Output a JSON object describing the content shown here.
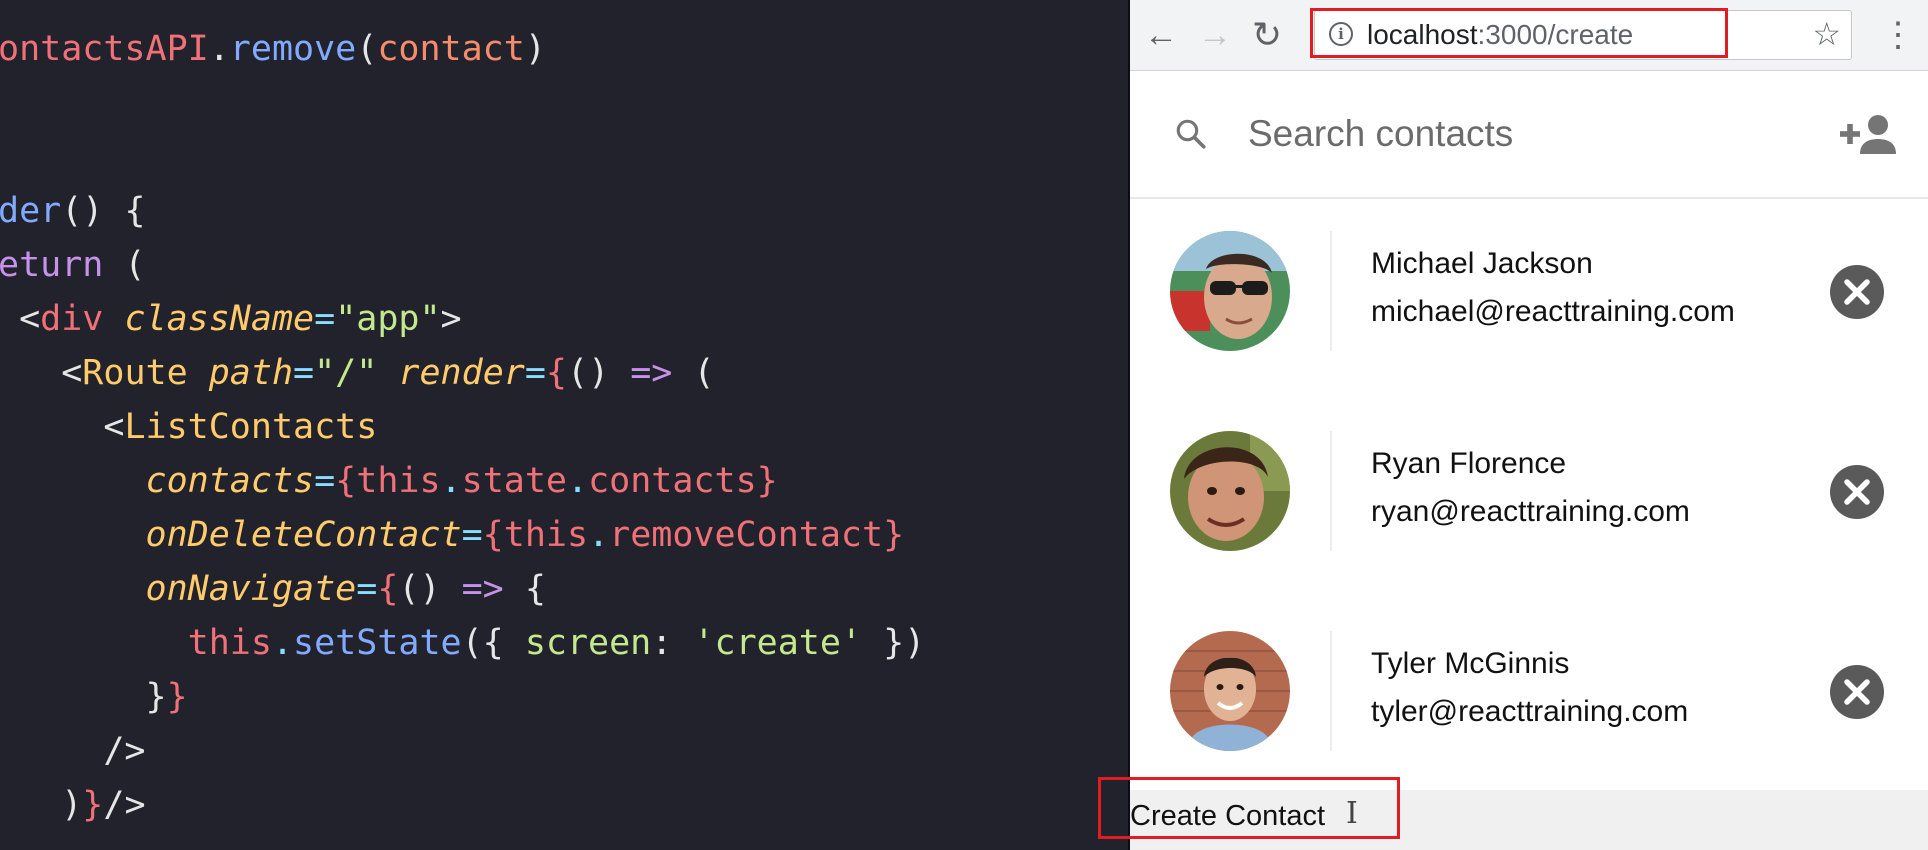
{
  "editor": {
    "lines": [
      [
        {
          "t": "ontactsAPI",
          "c": "#f07178"
        },
        {
          "t": ".",
          "c": "#e6e6e6"
        },
        {
          "t": "remove",
          "c": "#82aaff"
        },
        {
          "t": "(",
          "c": "#e6e6e6"
        },
        {
          "t": "contact",
          "c": "#f78c6c"
        },
        {
          "t": ")",
          "c": "#e6e6e6"
        }
      ],
      [],
      [],
      [
        {
          "t": "der",
          "c": "#82aaff"
        },
        {
          "t": "() {",
          "c": "#e6e6e6"
        }
      ],
      [
        {
          "t": "eturn",
          "c": "#c792ea"
        },
        {
          "t": " (",
          "c": "#e6e6e6"
        }
      ],
      [
        {
          "t": " <",
          "c": "#e6e6e6"
        },
        {
          "t": "div",
          "c": "#f07178"
        },
        {
          "t": " ",
          "c": "#e6e6e6"
        },
        {
          "t": "className",
          "c": "#ffcb6b",
          "i": true
        },
        {
          "t": "=",
          "c": "#89ddff"
        },
        {
          "t": "\"app\"",
          "c": "#c3e88d"
        },
        {
          "t": ">",
          "c": "#e6e6e6"
        }
      ],
      [
        {
          "t": "   <",
          "c": "#e6e6e6"
        },
        {
          "t": "Route",
          "c": "#ffcb6b"
        },
        {
          "t": " ",
          "c": "#e6e6e6"
        },
        {
          "t": "path",
          "c": "#ffcb6b",
          "i": true
        },
        {
          "t": "=",
          "c": "#89ddff"
        },
        {
          "t": "\"/\"",
          "c": "#c3e88d"
        },
        {
          "t": " ",
          "c": "#e6e6e6"
        },
        {
          "t": "render",
          "c": "#ffcb6b",
          "i": true
        },
        {
          "t": "=",
          "c": "#89ddff"
        },
        {
          "t": "{",
          "c": "#f07178"
        },
        {
          "t": "() ",
          "c": "#e6e6e6"
        },
        {
          "t": "=>",
          "c": "#c792ea"
        },
        {
          "t": " (",
          "c": "#e6e6e6"
        }
      ],
      [
        {
          "t": "     <",
          "c": "#e6e6e6"
        },
        {
          "t": "ListContacts",
          "c": "#ffcb6b"
        }
      ],
      [
        {
          "t": "       ",
          "c": "#e6e6e6"
        },
        {
          "t": "contacts",
          "c": "#ffcb6b",
          "i": true
        },
        {
          "t": "=",
          "c": "#89ddff"
        },
        {
          "t": "{",
          "c": "#f07178"
        },
        {
          "t": "this",
          "c": "#f07178"
        },
        {
          "t": ".",
          "c": "#89ddff"
        },
        {
          "t": "state",
          "c": "#f07178"
        },
        {
          "t": ".",
          "c": "#89ddff"
        },
        {
          "t": "contacts",
          "c": "#f07178"
        },
        {
          "t": "}",
          "c": "#f07178"
        }
      ],
      [
        {
          "t": "       ",
          "c": "#e6e6e6"
        },
        {
          "t": "onDeleteContact",
          "c": "#ffcb6b",
          "i": true
        },
        {
          "t": "=",
          "c": "#89ddff"
        },
        {
          "t": "{",
          "c": "#f07178"
        },
        {
          "t": "this",
          "c": "#f07178"
        },
        {
          "t": ".",
          "c": "#89ddff"
        },
        {
          "t": "removeContact",
          "c": "#f07178"
        },
        {
          "t": "}",
          "c": "#f07178"
        }
      ],
      [
        {
          "t": "       ",
          "c": "#e6e6e6"
        },
        {
          "t": "onNavigate",
          "c": "#ffcb6b",
          "i": true
        },
        {
          "t": "=",
          "c": "#89ddff"
        },
        {
          "t": "{",
          "c": "#f07178"
        },
        {
          "t": "() ",
          "c": "#e6e6e6"
        },
        {
          "t": "=>",
          "c": "#c792ea"
        },
        {
          "t": " {",
          "c": "#e6e6e6"
        }
      ],
      [
        {
          "t": "         ",
          "c": "#e6e6e6"
        },
        {
          "t": "this",
          "c": "#f07178"
        },
        {
          "t": ".",
          "c": "#89ddff"
        },
        {
          "t": "setState",
          "c": "#82aaff"
        },
        {
          "t": "({ ",
          "c": "#e6e6e6"
        },
        {
          "t": "screen",
          "c": "#c3e88d"
        },
        {
          "t": ": ",
          "c": "#e6e6e6"
        },
        {
          "t": "'create'",
          "c": "#c3e88d"
        },
        {
          "t": " })",
          "c": "#e6e6e6"
        }
      ],
      [
        {
          "t": "       }",
          "c": "#e6e6e6"
        },
        {
          "t": "}",
          "c": "#f07178"
        }
      ],
      [
        {
          "t": "     />",
          "c": "#e6e6e6"
        }
      ],
      [
        {
          "t": "   )",
          "c": "#e6e6e6"
        },
        {
          "t": "}",
          "c": "#f07178"
        },
        {
          "t": "/>",
          "c": "#e6e6e6"
        }
      ]
    ]
  },
  "browser": {
    "back_icon": "back-arrow",
    "forward_icon": "forward-arrow",
    "reload_icon": "reload",
    "url_host": "localhost",
    "url_path": ":3000/create",
    "bookmark_icon": "star",
    "menu_icon": "vertical-dots",
    "highlight_color": "#e31b23"
  },
  "search": {
    "placeholder": "Search contacts",
    "value": ""
  },
  "contacts": [
    {
      "name": "Michael Jackson",
      "email": "michael@reacttraining.com"
    },
    {
      "name": "Ryan Florence",
      "email": "ryan@reacttraining.com"
    },
    {
      "name": "Tyler McGinnis",
      "email": "tyler@reacttraining.com"
    }
  ],
  "footer": {
    "create_link": "Create Contact"
  }
}
